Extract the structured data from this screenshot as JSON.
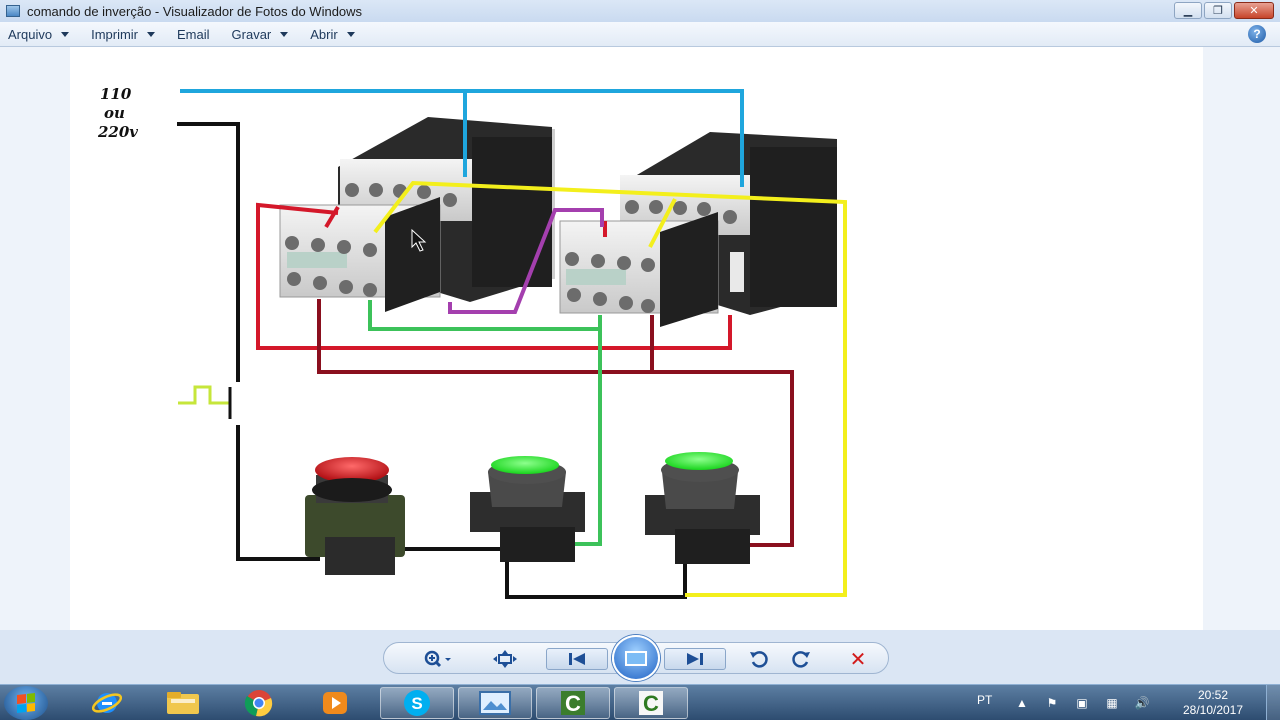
{
  "window": {
    "title": "comando de inverção - Visualizador de Fotos do Windows",
    "icon": "photo-viewer-icon"
  },
  "menu": [
    {
      "label": "Arquivo",
      "has_dropdown": true
    },
    {
      "label": "Imprimir",
      "has_dropdown": true
    },
    {
      "label": "Email",
      "has_dropdown": false
    },
    {
      "label": "Gravar",
      "has_dropdown": true
    },
    {
      "label": "Abrir",
      "has_dropdown": true
    }
  ],
  "image": {
    "voltage_lines": [
      "110",
      "ou",
      "220v"
    ],
    "wire_colors": {
      "supply_top": "#1fa6dd",
      "supply_black": "#111111",
      "red": "#d4182a",
      "dark_red": "#8a0f1e",
      "yellow": "#f3ef1c",
      "green": "#3cc25a",
      "purple": "#a43fae",
      "thermal": "#c6e63a"
    },
    "buttons": [
      "stop-button-red",
      "start-button-green-left",
      "start-button-green-right"
    ]
  },
  "toolbar": {
    "tools": [
      "zoom-icon",
      "fit-window-icon",
      "previous-icon",
      "slideshow-icon",
      "next-icon",
      "rotate-left-icon",
      "rotate-right-icon",
      "delete-icon"
    ]
  },
  "taskbar": {
    "apps": [
      "internet-explorer-icon",
      "file-explorer-icon",
      "chrome-icon",
      "media-player-icon",
      "skype-icon",
      "photo-viewer-icon",
      "cade-simu-icon",
      "cade-simu-icon-2"
    ],
    "language": "PT",
    "time": "20:52",
    "date": "28/10/2017"
  }
}
